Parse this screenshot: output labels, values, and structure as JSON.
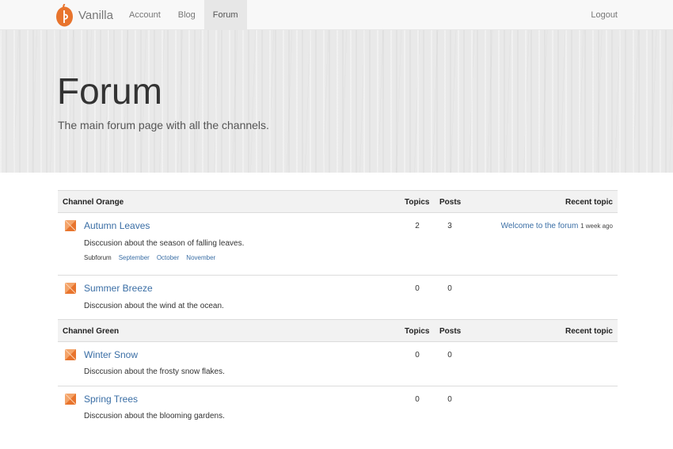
{
  "navbar": {
    "brand": "Vanilla",
    "items": [
      {
        "label": "Account",
        "active": false
      },
      {
        "label": "Blog",
        "active": false
      },
      {
        "label": "Forum",
        "active": true
      }
    ],
    "logout": "Logout"
  },
  "hero": {
    "title": "Forum",
    "subtitle": "The main forum page with all the channels."
  },
  "columns": {
    "topics": "Topics",
    "posts": "Posts",
    "recent": "Recent topic"
  },
  "channels": [
    {
      "name": "Channel Orange",
      "forums": [
        {
          "title": "Autumn Leaves",
          "description": "Disccusion about the season of falling leaves.",
          "topics": "2",
          "posts": "3",
          "recent_topic": "Welcome to the forum",
          "recent_time": "1 week ago",
          "subforum_label": "Subforum",
          "subforums": [
            "September",
            "October",
            "November"
          ]
        },
        {
          "title": "Summer Breeze",
          "description": "Disccusion about the wind at the ocean.",
          "topics": "0",
          "posts": "0"
        }
      ]
    },
    {
      "name": "Channel Green",
      "forums": [
        {
          "title": "Winter Snow",
          "description": "Disccusion about the frosty snow flakes.",
          "topics": "0",
          "posts": "0"
        },
        {
          "title": "Spring Trees",
          "description": "Disccusion about the blooming gardens.",
          "topics": "0",
          "posts": "0"
        }
      ]
    }
  ],
  "colors": {
    "accent": "#e8742d",
    "link": "#3a6ea5"
  }
}
